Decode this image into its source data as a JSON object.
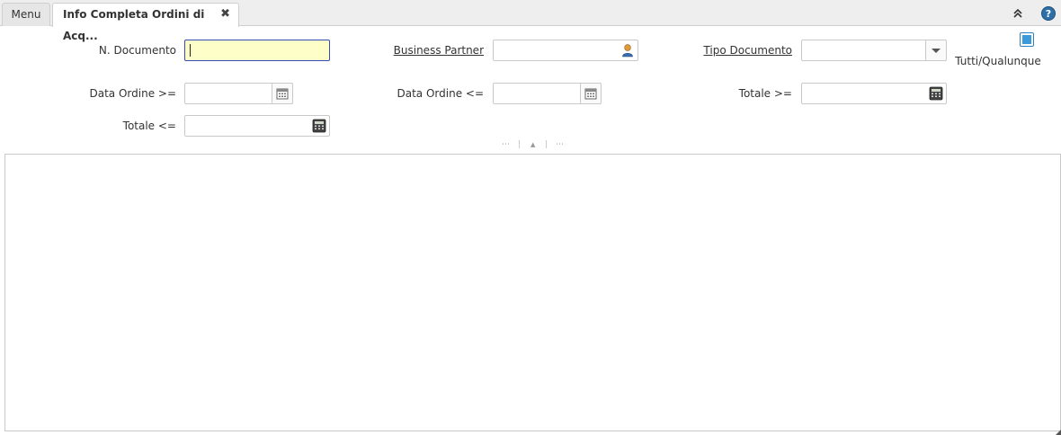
{
  "tabs": {
    "menu_label": "Menu",
    "active_label": "Info Completa Ordini di Acq...",
    "close_glyph": "✖"
  },
  "toolbar": {
    "collapse_icon": "chevron-double-up-icon",
    "help_glyph": "?"
  },
  "form": {
    "doc_no_label": "N. Documento",
    "doc_no_value": "",
    "bpartner_label": "Business Partner",
    "bpartner_value": "",
    "doctype_label": "Tipo Documento",
    "doctype_value": "",
    "all_any_label": "Tutti/Qualunque",
    "all_any_checked": true,
    "date_from_label": "Data Ordine >=",
    "date_from_value": "",
    "date_to_label": "Data Ordine <=",
    "date_to_value": "",
    "total_from_label": "Totale >=",
    "total_from_value": "",
    "total_to_label": "Totale <=",
    "total_to_value": ""
  },
  "colors": {
    "focus_bg": "#fefec9",
    "focus_border": "#3a4ab7",
    "accent": "#3b9ad9"
  },
  "splitter": {
    "left_glyph": "⋯",
    "center_glyph": "▲",
    "right_glyph": "⋯"
  }
}
